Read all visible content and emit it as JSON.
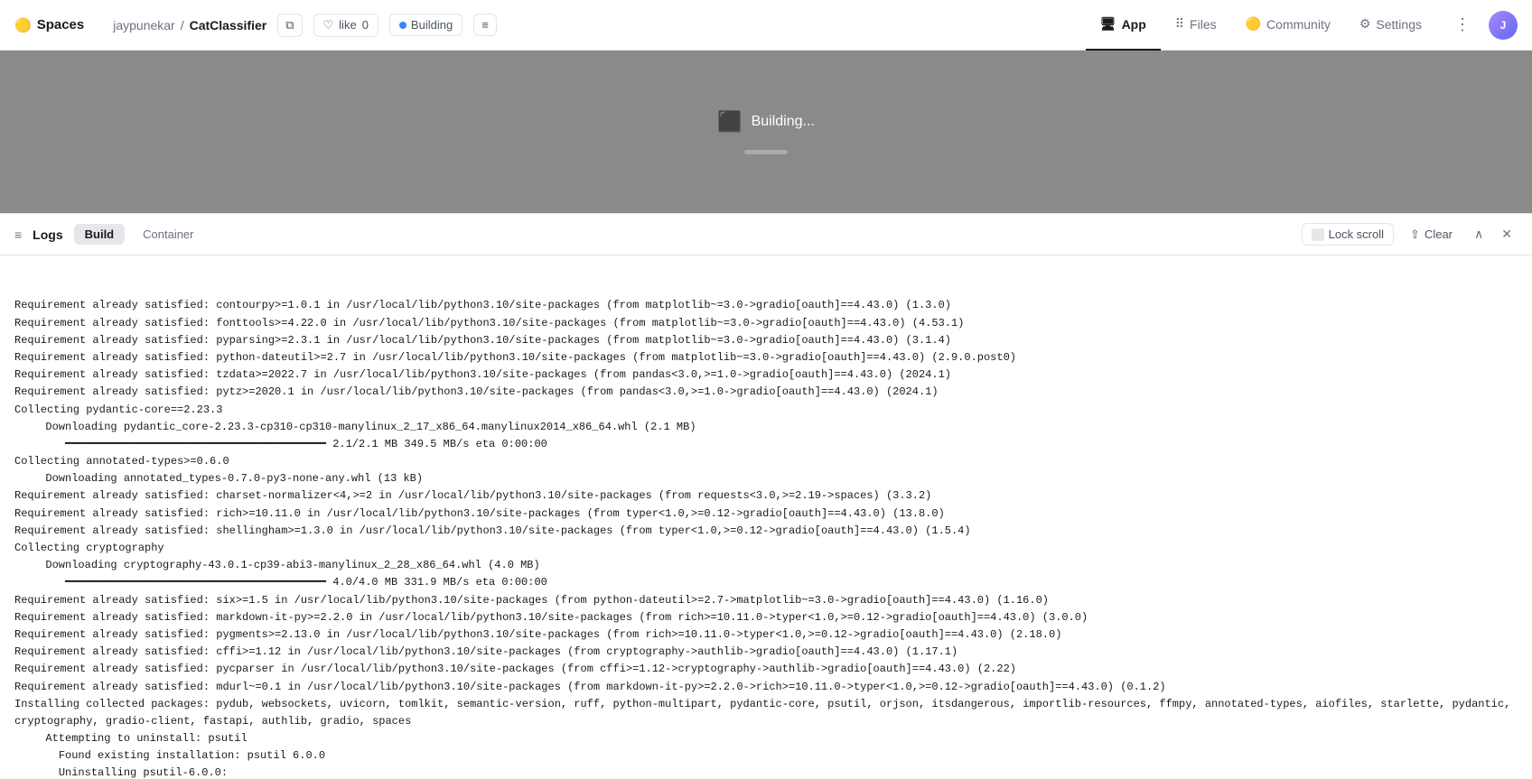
{
  "brand": {
    "logo_emoji": "🟡",
    "logo_label": "Spaces"
  },
  "repo": {
    "user": "jaypunekar",
    "separator": "/",
    "name": "CatClassifier"
  },
  "navbar": {
    "copy_icon": "⧉",
    "like_label": "like",
    "like_count": "0",
    "status_label": "Building",
    "list_icon": "≡",
    "tabs": [
      {
        "id": "app",
        "label": "App",
        "icon": "🖥️",
        "active": true
      },
      {
        "id": "files",
        "label": "Files",
        "icon": "|||"
      },
      {
        "id": "community",
        "label": "Community",
        "icon": "🟡"
      },
      {
        "id": "settings",
        "label": "Settings",
        "icon": "⚙️"
      }
    ],
    "more_label": "⋮"
  },
  "building": {
    "cube_icon": "⬛",
    "label": "Building..."
  },
  "logs": {
    "panel_icon": "≡",
    "panel_title": "Logs",
    "tabs": [
      {
        "id": "build",
        "label": "Build",
        "active": true
      },
      {
        "id": "container",
        "label": "Container",
        "active": false
      }
    ],
    "lock_scroll_label": "Lock scroll",
    "clear_label": "Clear",
    "collapse_icon": "∧",
    "close_icon": "✕",
    "lines": [
      "Requirement already satisfied: contourpy>=1.0.1 in /usr/local/lib/python3.10/site-packages (from matplotlib~=3.0->gradio[oauth]==4.43.0) (1.3.0)",
      "Requirement already satisfied: fonttools>=4.22.0 in /usr/local/lib/python3.10/site-packages (from matplotlib~=3.0->gradio[oauth]==4.43.0) (4.53.1)",
      "Requirement already satisfied: pyparsing>=2.3.1 in /usr/local/lib/python3.10/site-packages (from matplotlib~=3.0->gradio[oauth]==4.43.0) (3.1.4)",
      "Requirement already satisfied: python-dateutil>=2.7 in /usr/local/lib/python3.10/site-packages (from matplotlib~=3.0->gradio[oauth]==4.43.0) (2.9.0.post0)",
      "Requirement already satisfied: tzdata>=2022.7 in /usr/local/lib/python3.10/site-packages (from pandas<3.0,>=1.0->gradio[oauth]==4.43.0) (2024.1)",
      "Requirement already satisfied: pytz>=2020.1 in /usr/local/lib/python3.10/site-packages (from pandas<3.0,>=1.0->gradio[oauth]==4.43.0) (2024.1)",
      "Collecting pydantic-core==2.23.3",
      "  Downloading pydantic_core-2.23.3-cp310-cp310-manylinux_2_17_x86_64.manylinux2014_x86_64.whl (2.1 MB)",
      "     ━━━━━━━━━━━━━━━━━━━━━━━━━━━━━━━━━━━━━━━━ 2.1/2.1 MB 349.5 MB/s eta 0:00:00",
      "Collecting annotated-types>=0.6.0",
      "  Downloading annotated_types-0.7.0-py3-none-any.whl (13 kB)",
      "Requirement already satisfied: charset-normalizer<4,>=2 in /usr/local/lib/python3.10/site-packages (from requests<3.0,>=2.19->spaces) (3.3.2)",
      "Requirement already satisfied: rich>=10.11.0 in /usr/local/lib/python3.10/site-packages (from typer<1.0,>=0.12->gradio[oauth]==4.43.0) (13.8.0)",
      "Requirement already satisfied: shellingham>=1.3.0 in /usr/local/lib/python3.10/site-packages (from typer<1.0,>=0.12->gradio[oauth]==4.43.0) (1.5.4)",
      "Collecting cryptography",
      "  Downloading cryptography-43.0.1-cp39-abi3-manylinux_2_28_x86_64.whl (4.0 MB)",
      "     ━━━━━━━━━━━━━━━━━━━━━━━━━━━━━━━━━━━━━━━━ 4.0/4.0 MB 331.9 MB/s eta 0:00:00",
      "Requirement already satisfied: six>=1.5 in /usr/local/lib/python3.10/site-packages (from python-dateutil>=2.7->matplotlib~=3.0->gradio[oauth]==4.43.0) (1.16.0)",
      "Requirement already satisfied: markdown-it-py>=2.2.0 in /usr/local/lib/python3.10/site-packages (from rich>=10.11.0->typer<1.0,>=0.12->gradio[oauth]==4.43.0) (3.0.0)",
      "Requirement already satisfied: pygments>=2.13.0 in /usr/local/lib/python3.10/site-packages (from rich>=10.11.0->typer<1.0,>=0.12->gradio[oauth]==4.43.0) (2.18.0)",
      "Requirement already satisfied: cffi>=1.12 in /usr/local/lib/python3.10/site-packages (from cryptography->authlib->gradio[oauth]==4.43.0) (1.17.1)",
      "Requirement already satisfied: pycparser in /usr/local/lib/python3.10/site-packages (from cffi>=1.12->cryptography->authlib->gradio[oauth]==4.43.0) (2.22)",
      "Requirement already satisfied: mdurl~=0.1 in /usr/local/lib/python3.10/site-packages (from markdown-it-py>=2.2.0->rich>=10.11.0->typer<1.0,>=0.12->gradio[oauth]==4.43.0) (0.1.2)",
      "Installing collected packages: pydub, websockets, uvicorn, tomlkit, semantic-version, ruff, python-multipart, pydantic-core, psutil, orjson, itsdangerous, importlib-resources, ffmpy, annotated-types, aiofiles, starlette, pydantic, cryptography, gradio-client, fastapi, authlib, gradio, spaces",
      "  Attempting to uninstall: psutil",
      "    Found existing installation: psutil 6.0.0",
      "    Uninstalling psutil-6.0.0:"
    ]
  }
}
